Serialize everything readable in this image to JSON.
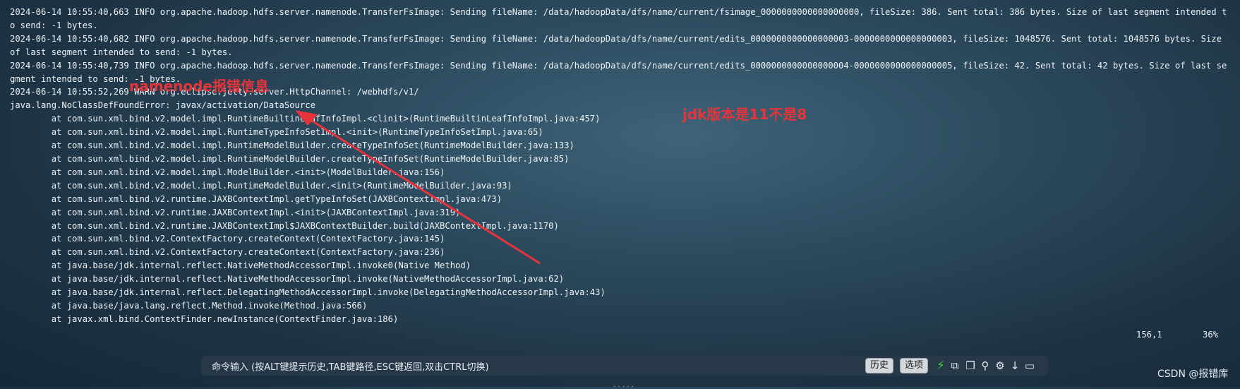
{
  "terminal": {
    "lines": [
      "2024-06-14 10:55:40,663 INFO org.apache.hadoop.hdfs.server.namenode.TransferFsImage: Sending fileName: /data/hadoopData/dfs/name/current/fsimage_0000000000000000000, fileSize: 386. Sent total: 386 bytes. Size of last segment intended to send: -1 bytes.",
      "2024-06-14 10:55:40,682 INFO org.apache.hadoop.hdfs.server.namenode.TransferFsImage: Sending fileName: /data/hadoopData/dfs/name/current/edits_0000000000000000003-0000000000000000003, fileSize: 1048576. Sent total: 1048576 bytes. Size of last segment intended to send: -1 bytes.",
      "2024-06-14 10:55:40,739 INFO org.apache.hadoop.hdfs.server.namenode.TransferFsImage: Sending fileName: /data/hadoopData/dfs/name/current/edits_0000000000000000004-0000000000000000005, fileSize: 42. Sent total: 42 bytes. Size of last segment intended to send: -1 bytes.",
      "2024-06-14 10:55:52,269 WARN org.eclipse.jetty.server.HttpChannel: /webhdfs/v1/",
      "java.lang.NoClassDefFoundError: javax/activation/DataSource",
      "        at com.sun.xml.bind.v2.model.impl.RuntimeBuiltinLeafInfoImpl.<clinit>(RuntimeBuiltinLeafInfoImpl.java:457)",
      "        at com.sun.xml.bind.v2.model.impl.RuntimeTypeInfoSetImpl.<init>(RuntimeTypeInfoSetImpl.java:65)",
      "        at com.sun.xml.bind.v2.model.impl.RuntimeModelBuilder.createTypeInfoSet(RuntimeModelBuilder.java:133)",
      "        at com.sun.xml.bind.v2.model.impl.RuntimeModelBuilder.createTypeInfoSet(RuntimeModelBuilder.java:85)",
      "        at com.sun.xml.bind.v2.model.impl.ModelBuilder.<init>(ModelBuilder.java:156)",
      "        at com.sun.xml.bind.v2.model.impl.RuntimeModelBuilder.<init>(RuntimeModelBuilder.java:93)",
      "        at com.sun.xml.bind.v2.runtime.JAXBContextImpl.getTypeInfoSet(JAXBContextImpl.java:473)",
      "        at com.sun.xml.bind.v2.runtime.JAXBContextImpl.<init>(JAXBContextImpl.java:319)",
      "        at com.sun.xml.bind.v2.runtime.JAXBContextImpl$JAXBContextBuilder.build(JAXBContextImpl.java:1170)",
      "        at com.sun.xml.bind.v2.ContextFactory.createContext(ContextFactory.java:145)",
      "        at com.sun.xml.bind.v2.ContextFactory.createContext(ContextFactory.java:236)",
      "        at java.base/jdk.internal.reflect.NativeMethodAccessorImpl.invoke0(Native Method)",
      "        at java.base/jdk.internal.reflect.NativeMethodAccessorImpl.invoke(NativeMethodAccessorImpl.java:62)",
      "        at java.base/jdk.internal.reflect.DelegatingMethodAccessorImpl.invoke(DelegatingMethodAccessorImpl.java:43)",
      "        at java.base/java.lang.reflect.Method.invoke(Method.java:566)",
      "        at javax.xml.bind.ContextFinder.newInstance(ContextFinder.java:186)"
    ],
    "cursor_position": "156,1",
    "scroll_percent": "36%"
  },
  "annotations": {
    "namenode_error": "namenode报错信息",
    "jdk_version": "jdk版本是11不是8",
    "color": "#e8333a"
  },
  "command_bar": {
    "placeholder": "命令输入 (按ALT键提示历史,TAB键路径,ESC键返回,双击CTRL切换)",
    "history_button": "历史",
    "options_button": "选项",
    "icons": [
      "lightning-icon",
      "copy-icon",
      "paste-icon",
      "search-icon",
      "gear-icon",
      "download-icon",
      "window-icon"
    ]
  },
  "watermark": "CSDN @报错库"
}
